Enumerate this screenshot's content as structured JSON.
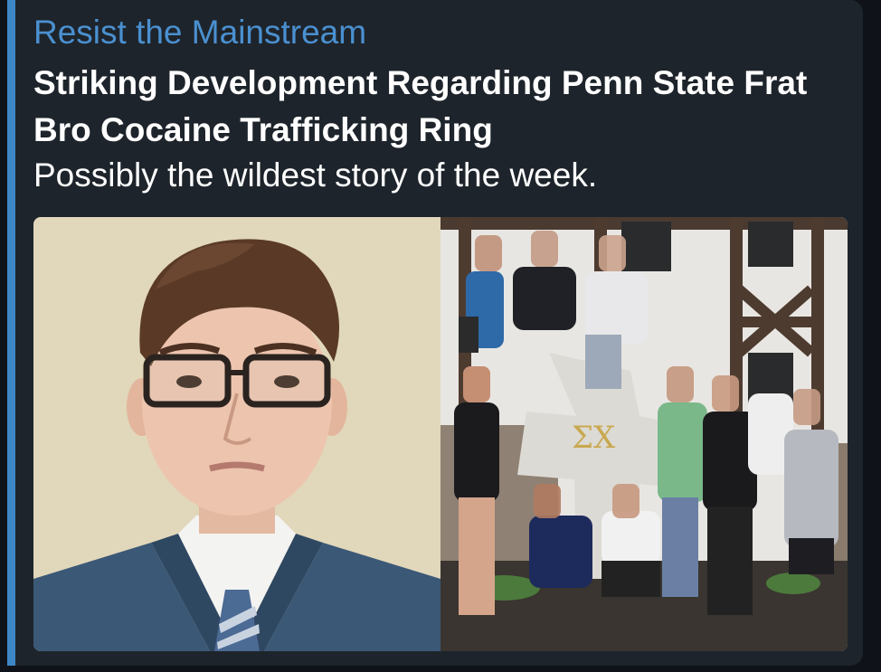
{
  "preview": {
    "source": "Resist the Mainstream",
    "title": "Striking Development Regarding Penn State Frat Bro Cocaine Trafficking Ring",
    "description": "Possibly the wildest story of the week.",
    "image": {
      "left_photo": "mugshot",
      "right_photo": "group-photo",
      "sign_text": "ΣΧ"
    }
  },
  "colors": {
    "background": "#0f1319",
    "card": "#1e242b",
    "accent": "#3f86c7",
    "source_link": "#4a90d0",
    "text": "#ffffff"
  }
}
